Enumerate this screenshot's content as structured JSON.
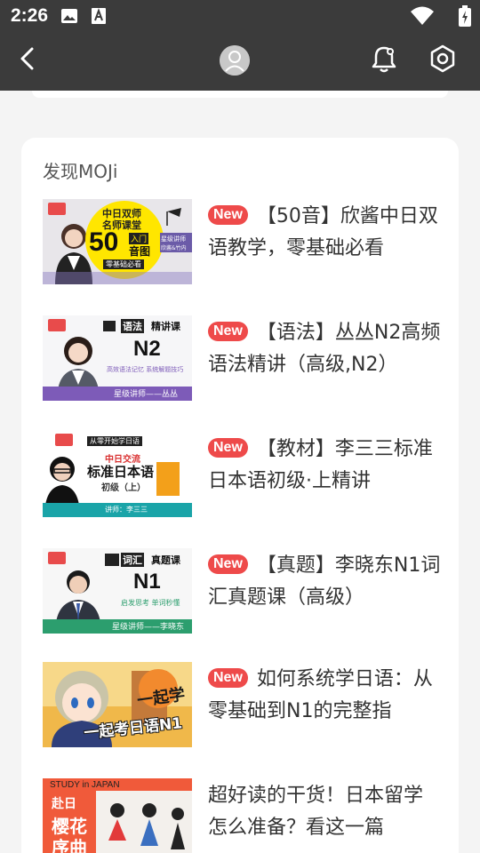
{
  "status_bar": {
    "time": "2:26",
    "icons": [
      "image-icon",
      "a-icon",
      "wifi-icon",
      "battery-icon"
    ]
  },
  "app_bar": {
    "back_icon": "chevron-left-icon",
    "avatar_icon": "user-icon",
    "notification_icon": "bell-icon",
    "settings_icon": "hexagon-settings-icon"
  },
  "card": {
    "title": "发现MOJi",
    "badge_label": "New",
    "items": [
      {
        "has_new": true,
        "title": "【50音】欣酱中日双语教学，零基础必看",
        "thumb": {
          "line1": "中日双师",
          "line2": "名师课堂",
          "big": "50",
          "tag1": "入门",
          "tag2": "音图",
          "sub": "零基础必看",
          "side1": "星级讲师",
          "side2": "欣酱&竹内"
        }
      },
      {
        "has_new": true,
        "title": "【语法】丛丛N2高频语法精讲（高级,N2）",
        "thumb": {
          "kicker": "语法",
          "kicker2": "精讲课",
          "big": "N2",
          "sub": "高效语法记忆 系统解题技巧",
          "footer": "星级讲师——丛丛"
        }
      },
      {
        "has_new": true,
        "title": "【教材】李三三标准日本语初级·上精讲",
        "thumb": {
          "kicker": "从零开始学日语",
          "line1": "中日交流",
          "line2": "标准日本语",
          "line3": "初级（上）",
          "footer": "讲师：李三三"
        }
      },
      {
        "has_new": true,
        "title": "【真题】李晓东N1词汇真题课（高级）",
        "thumb": {
          "kicker": "词汇",
          "kicker2": "真题课",
          "big": "N1",
          "sub": "启发思考 单词秒懂",
          "footer": "星级讲师——李晓东"
        }
      },
      {
        "has_new": true,
        "title": "如何系统学日语：从零基础到N1的完整指",
        "thumb": {
          "line1": "一起学",
          "line2": "一起考日语N1"
        }
      },
      {
        "has_new": false,
        "title": "超好读的干货！日本留学怎么准备？看这一篇",
        "thumb": {
          "kicker": "STUDY in JAPAN",
          "line1": "赴日",
          "line2": "樱花",
          "line3": "序曲"
        }
      }
    ]
  },
  "colors": {
    "status_bar": "#3b3b3b",
    "badge": "#ee4a4a",
    "card_bg": "#ffffff",
    "page_bg": "#f4f4f4"
  }
}
